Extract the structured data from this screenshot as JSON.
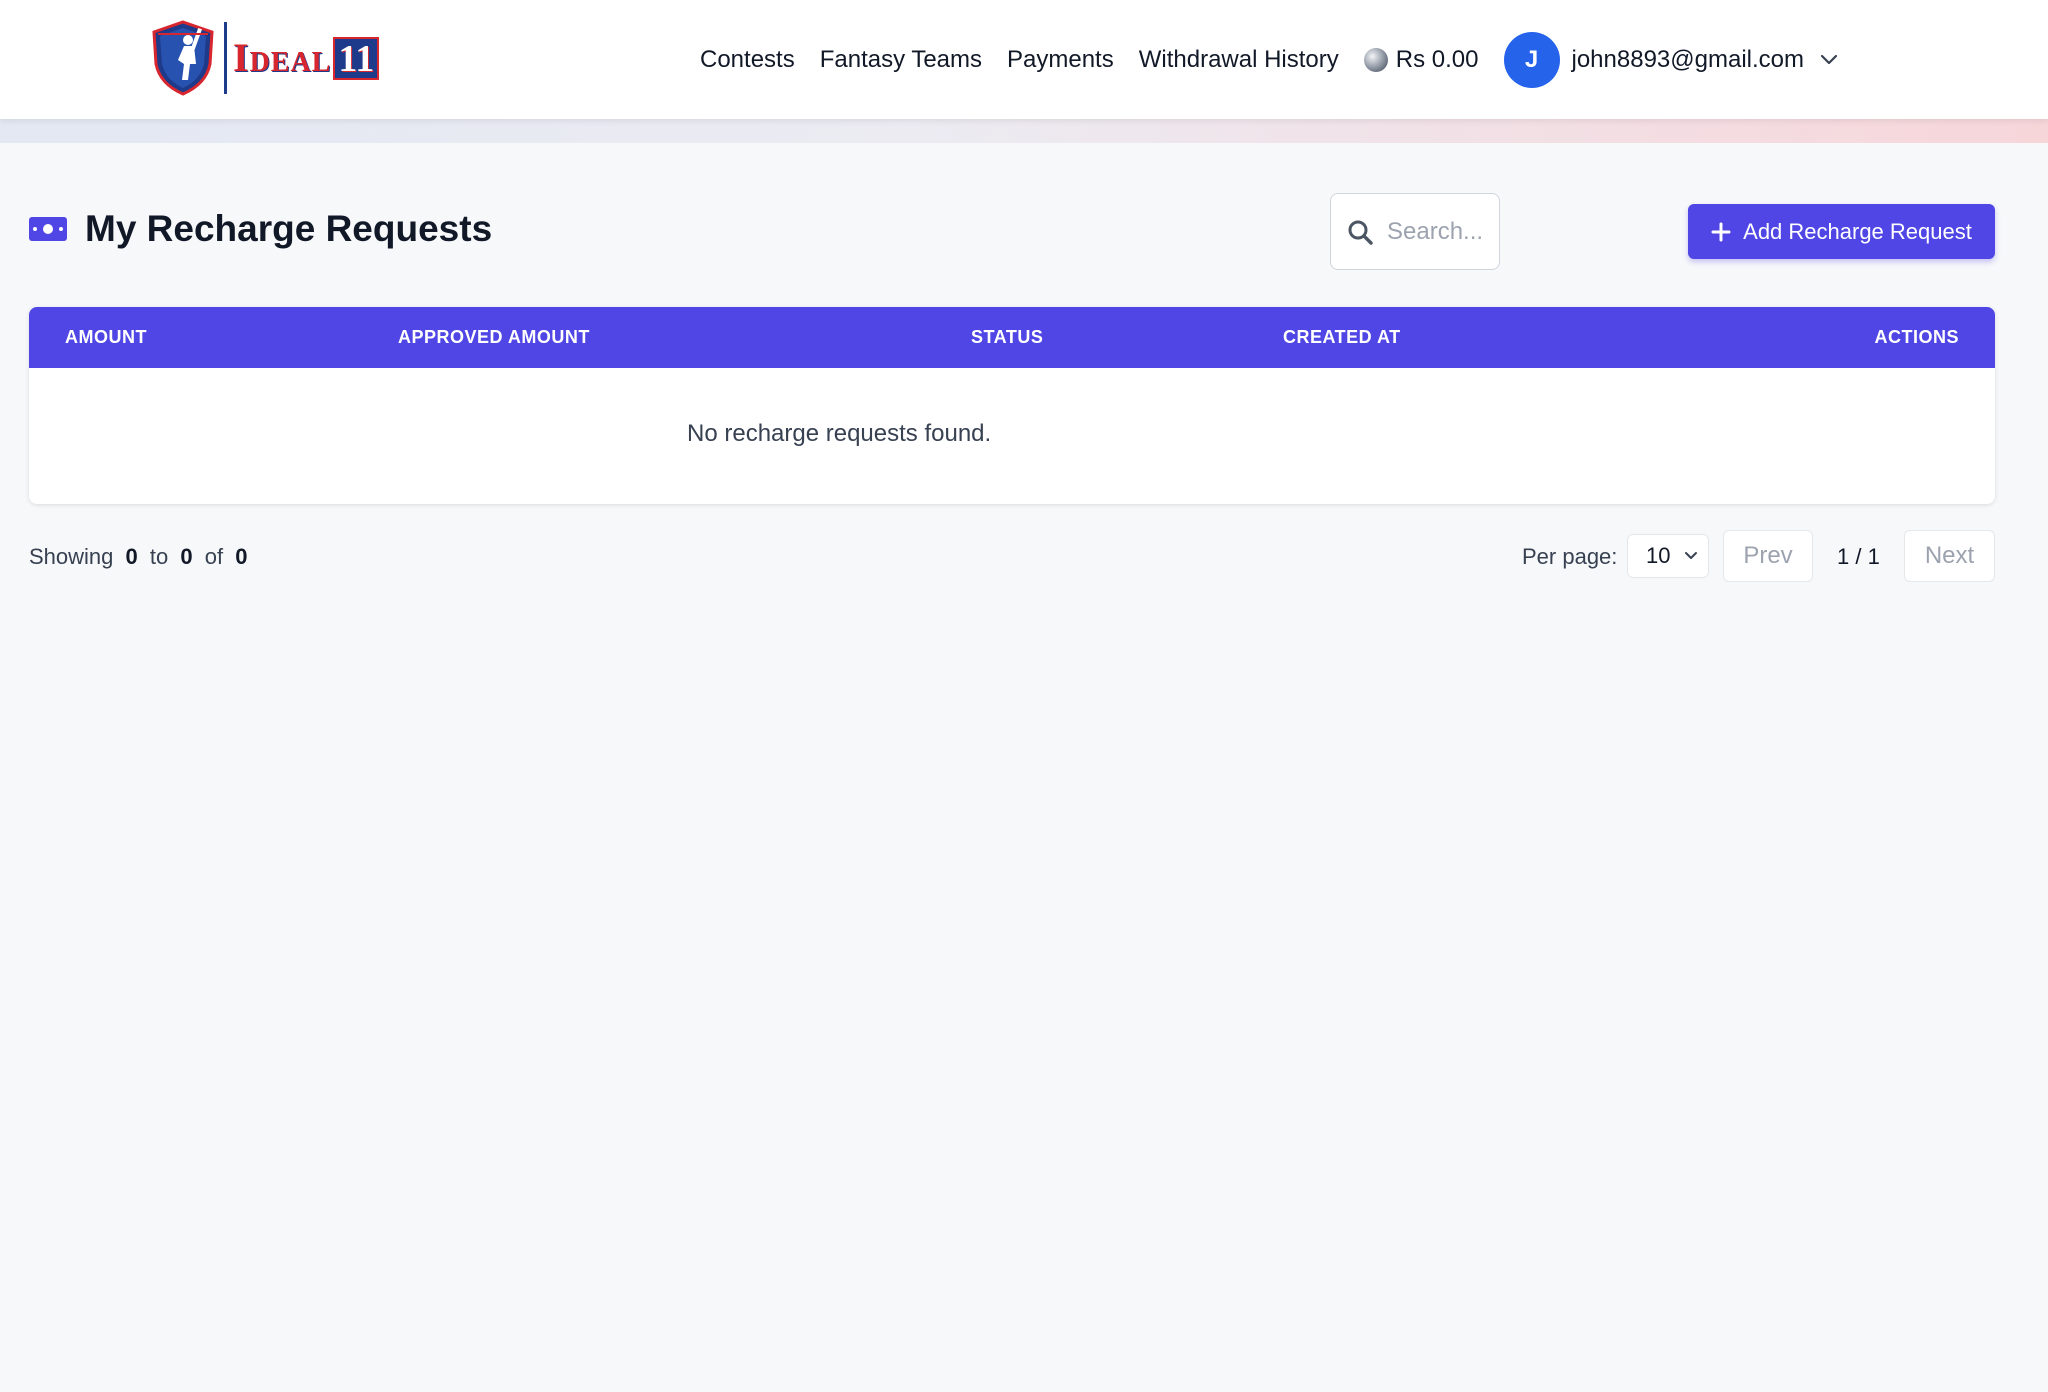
{
  "header": {
    "brand_word": "Ideal",
    "brand_number": "11",
    "nav": [
      {
        "label": "Contests"
      },
      {
        "label": "Fantasy Teams"
      },
      {
        "label": "Payments"
      },
      {
        "label": "Withdrawal History"
      }
    ],
    "balance": "Rs 0.00",
    "user": {
      "avatar_initial": "J",
      "email": "john8893@gmail.com"
    }
  },
  "page": {
    "title": "My Recharge Requests",
    "icon": "money-bill-icon",
    "search_placeholder": "Search...",
    "add_button_label": "Add Recharge Request"
  },
  "table": {
    "columns": [
      "AMOUNT",
      "APPROVED AMOUNT",
      "STATUS",
      "CREATED AT",
      "ACTIONS"
    ],
    "rows": [],
    "empty_message": "No recharge requests found."
  },
  "pagination": {
    "showing_label": "Showing",
    "from": "0",
    "to_label": "to",
    "to": "0",
    "of_label": "of",
    "total": "0",
    "per_page_label": "Per page:",
    "per_page_value": "10",
    "prev_label": "Prev",
    "next_label": "Next",
    "page_indicator": "1 / 1"
  },
  "colors": {
    "accent": "#4f46e5",
    "avatar": "#2563eb",
    "brand_red": "#d7262e",
    "brand_blue": "#1e3a8a"
  }
}
